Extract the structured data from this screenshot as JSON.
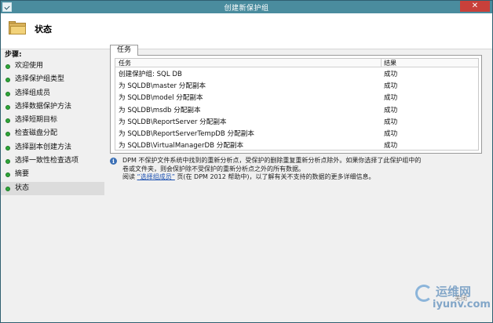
{
  "window": {
    "title": "创建新保护组",
    "close_glyph": "✕"
  },
  "header": {
    "title": "状态"
  },
  "sidebar": {
    "steps_label": "步骤:",
    "items": [
      {
        "label": "欢迎使用"
      },
      {
        "label": "选择保护组类型"
      },
      {
        "label": "选择组成员"
      },
      {
        "label": "选择数据保护方法"
      },
      {
        "label": "选择短期目标"
      },
      {
        "label": "检查磁盘分配"
      },
      {
        "label": "选择副本创建方法"
      },
      {
        "label": "选择一致性检查选项"
      },
      {
        "label": "摘要"
      },
      {
        "label": "状态",
        "active": true
      }
    ]
  },
  "tab": {
    "label": "任务"
  },
  "grid": {
    "columns": [
      "任务",
      "结果"
    ],
    "rows": [
      {
        "task": "创建保护组: SQL DB",
        "result": "成功"
      },
      {
        "task": "为 SQLDB\\master 分配副本",
        "result": "成功"
      },
      {
        "task": "为 SQLDB\\model 分配副本",
        "result": "成功"
      },
      {
        "task": "为 SQLDB\\msdb 分配副本",
        "result": "成功"
      },
      {
        "task": "为 SQLDB\\ReportServer 分配副本",
        "result": "成功"
      },
      {
        "task": "为 SQLDB\\ReportServerTempDB 分配副本",
        "result": "成功"
      },
      {
        "task": "为 SQLDB\\VirtualManagerDB 分配副本",
        "result": "成功"
      }
    ]
  },
  "info": {
    "line1": "DPM 不保护文件系统中找到的重新分析点，受保护的删除重复重新分析点除外。如果你选择了此保护组中的",
    "line2": "卷或文件夹，则会保护除不受保护的重新分析点之外的所有数据。",
    "line3_prefix": "阅读",
    "link": "“选择组成员”",
    "line3_suffix": "页(在 DPM 2012 帮助中)，以了解有关不支持的数据的更多详细信息。"
  },
  "watermark": {
    "text1": "运维网",
    "text2": "iyunv.com",
    "button_fragment": "关闭"
  },
  "colors": {
    "titlebar": "#4a8c9e",
    "close": "#c8403a",
    "status_dot": "#2fa63a",
    "link": "#1a4fb0"
  }
}
